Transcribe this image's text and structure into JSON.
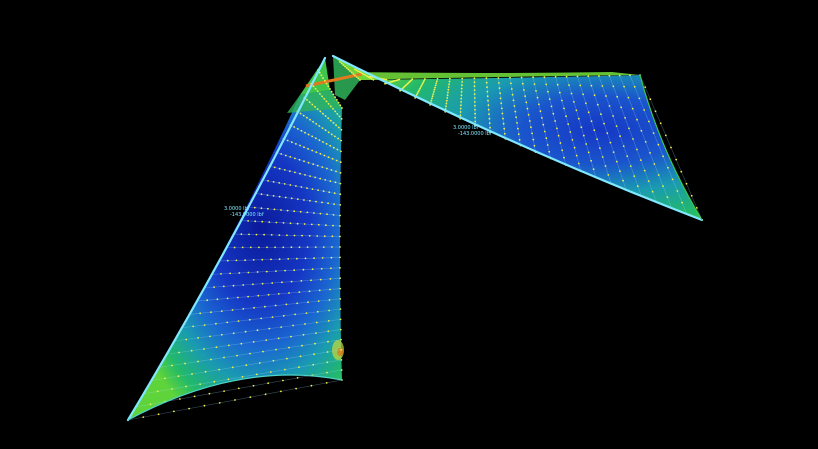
{
  "viewport": {
    "background": "#000000",
    "contour_colors": [
      "#0a1a9a",
      "#1537c4",
      "#1a66d0",
      "#1a9bb0",
      "#22b96a",
      "#5fd43a",
      "#c8d83a",
      "#e07a20"
    ]
  },
  "labels": {
    "left_surface": {
      "line1": "3.0000 lbf",
      "line2": "-143.0000 lbf"
    },
    "right_surface": {
      "line1": "3.0000 lbf",
      "line2": "-143.0000 lbf"
    }
  }
}
